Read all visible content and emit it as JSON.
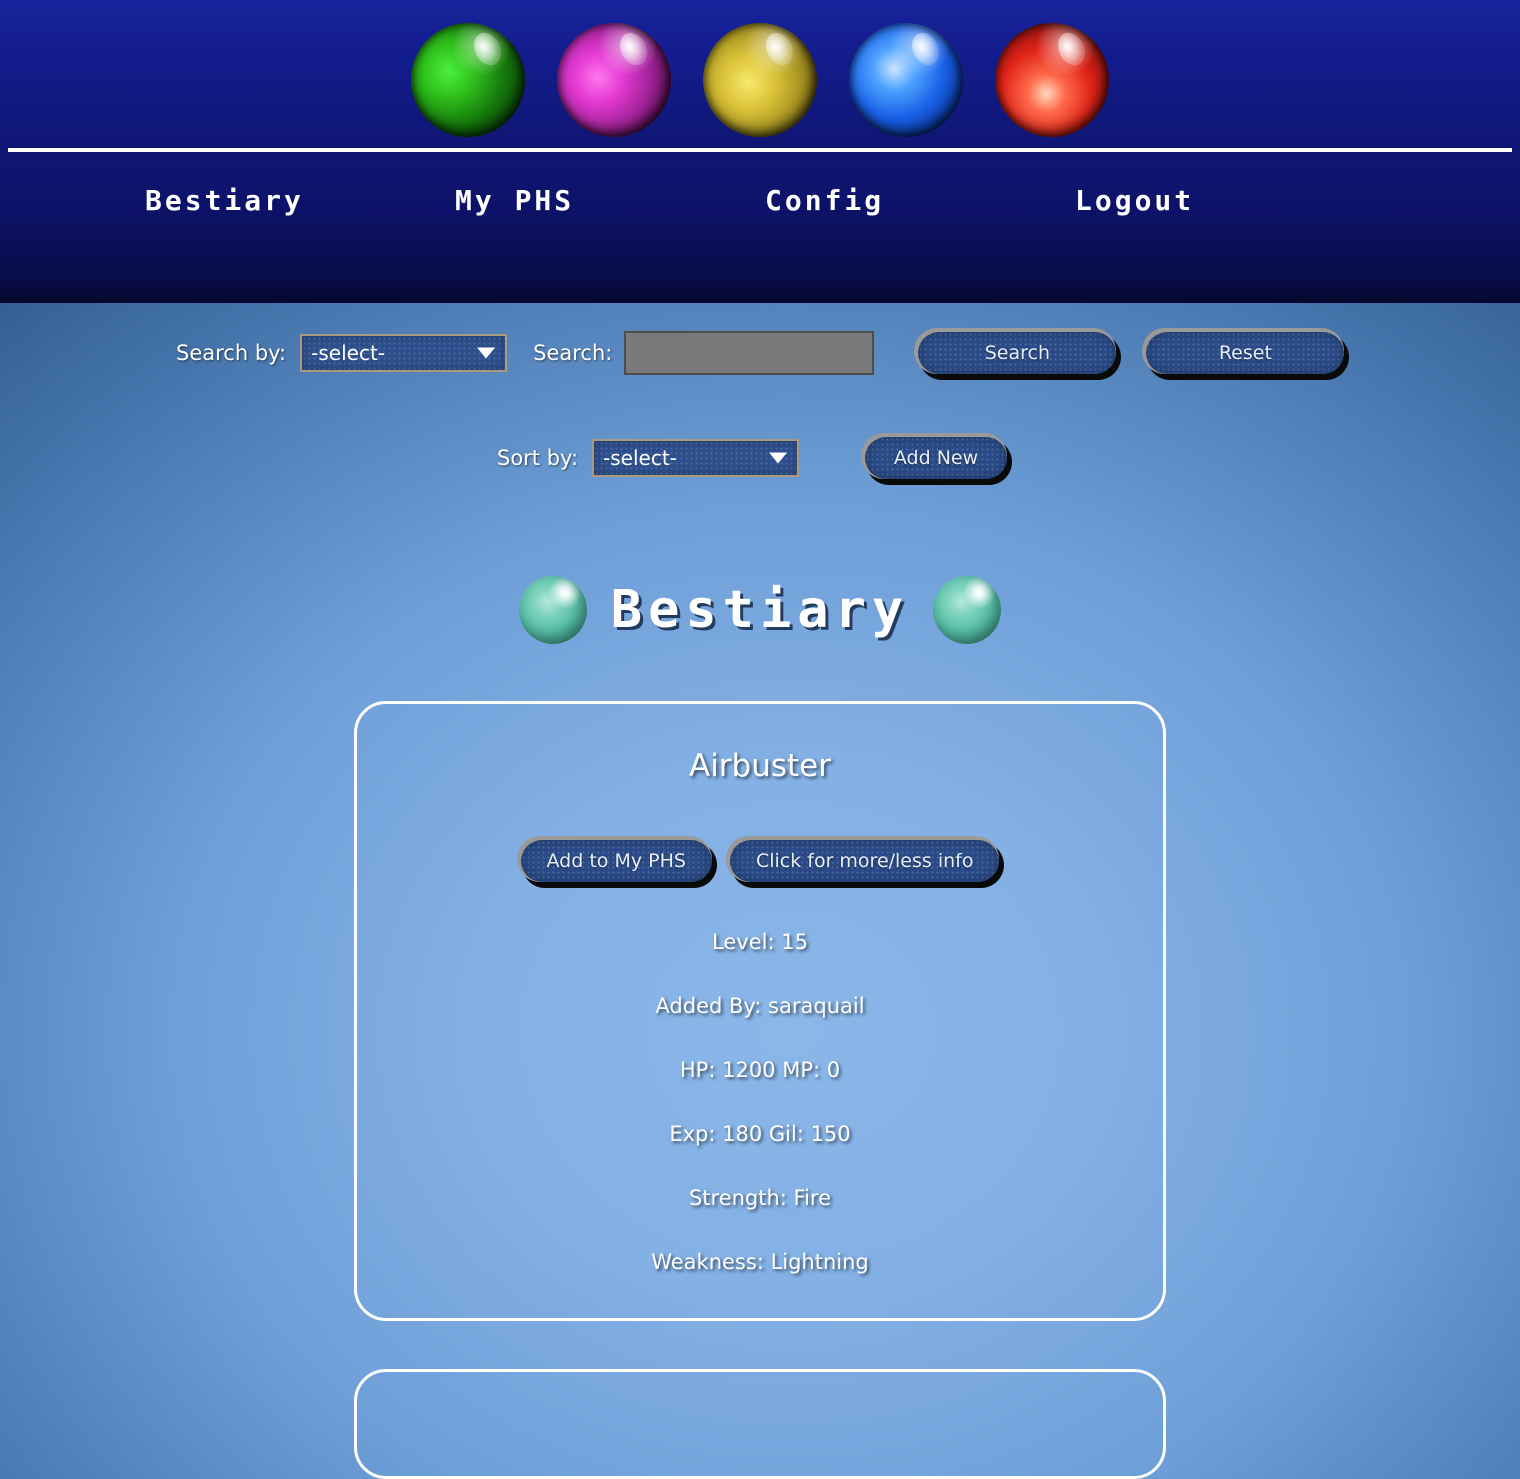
{
  "header": {
    "materia_orbs": [
      {
        "name": "materia-orb-green",
        "color": "#2fbf1c"
      },
      {
        "name": "materia-orb-purple",
        "color": "#e43ad2"
      },
      {
        "name": "materia-orb-yellow",
        "color": "#ddc53a"
      },
      {
        "name": "materia-orb-blue",
        "color": "#1a62e8"
      },
      {
        "name": "materia-orb-red",
        "color": "#e02318"
      }
    ],
    "nav": [
      {
        "label": "Bestiary"
      },
      {
        "label": "My PHS"
      },
      {
        "label": "Config"
      },
      {
        "label": "Logout"
      }
    ]
  },
  "search": {
    "search_by_label": "Search by:",
    "search_by_value": "-select-",
    "search_label": "Search:",
    "search_input_value": "",
    "search_input_placeholder": "",
    "search_button": "Search",
    "reset_button": "Reset"
  },
  "sort": {
    "sort_by_label": "Sort by:",
    "sort_by_value": "-select-",
    "add_new_button": "Add New"
  },
  "page": {
    "title": "Bestiary"
  },
  "monsters": [
    {
      "name": "Airbuster",
      "add_button": "Add to My PHS",
      "info_button": "Click for more/less info",
      "stats": [
        "Level: 15",
        "Added By: saraquail",
        "HP: 1200 MP: 0",
        "Exp: 180 Gil: 150",
        "Strength: Fire",
        "Weakness: Lightning"
      ]
    }
  ],
  "colors": {
    "header_top": "#18239c",
    "header_bottom": "#05082c",
    "body_center": "#8ab6e8",
    "body_edge": "#2f5d93",
    "button_fill": "#2a4b88",
    "select_border": "#a79a7e",
    "input_fill": "#7a7a7a",
    "text_white": "#ffffff"
  }
}
